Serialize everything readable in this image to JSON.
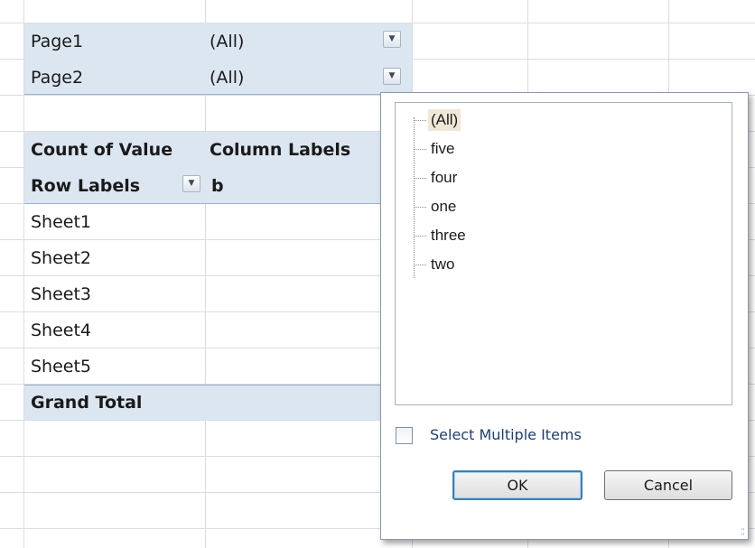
{
  "report_filters": [
    {
      "field": "Page1",
      "value": "(All)"
    },
    {
      "field": "Page2",
      "value": "(All)"
    }
  ],
  "pivot": {
    "values_header": "Count of Value",
    "column_labels_header": "Column Labels",
    "row_labels_header": "Row Labels",
    "column_item": "b",
    "rows": [
      "Sheet1",
      "Sheet2",
      "Sheet3",
      "Sheet4",
      "Sheet5"
    ],
    "grand_total": "Grand Total"
  },
  "filter_popup": {
    "items": [
      "(All)",
      "five",
      "four",
      "one",
      "three",
      "two"
    ],
    "selected_item": "(All)",
    "select_multiple_label": "Select Multiple Items",
    "select_multiple_checked": false,
    "ok_label": "OK",
    "cancel_label": "Cancel"
  },
  "icons": {
    "dropdown": "chevron-down-icon",
    "resize_grip": "resize-grip-icon"
  },
  "colors": {
    "pivot_band": "#dce6f1",
    "band_border": "#95b3d7",
    "gridline": "#d9dde3",
    "checkbox_label": "#1f3f73",
    "selected_item_bg": "#efe8d6"
  }
}
